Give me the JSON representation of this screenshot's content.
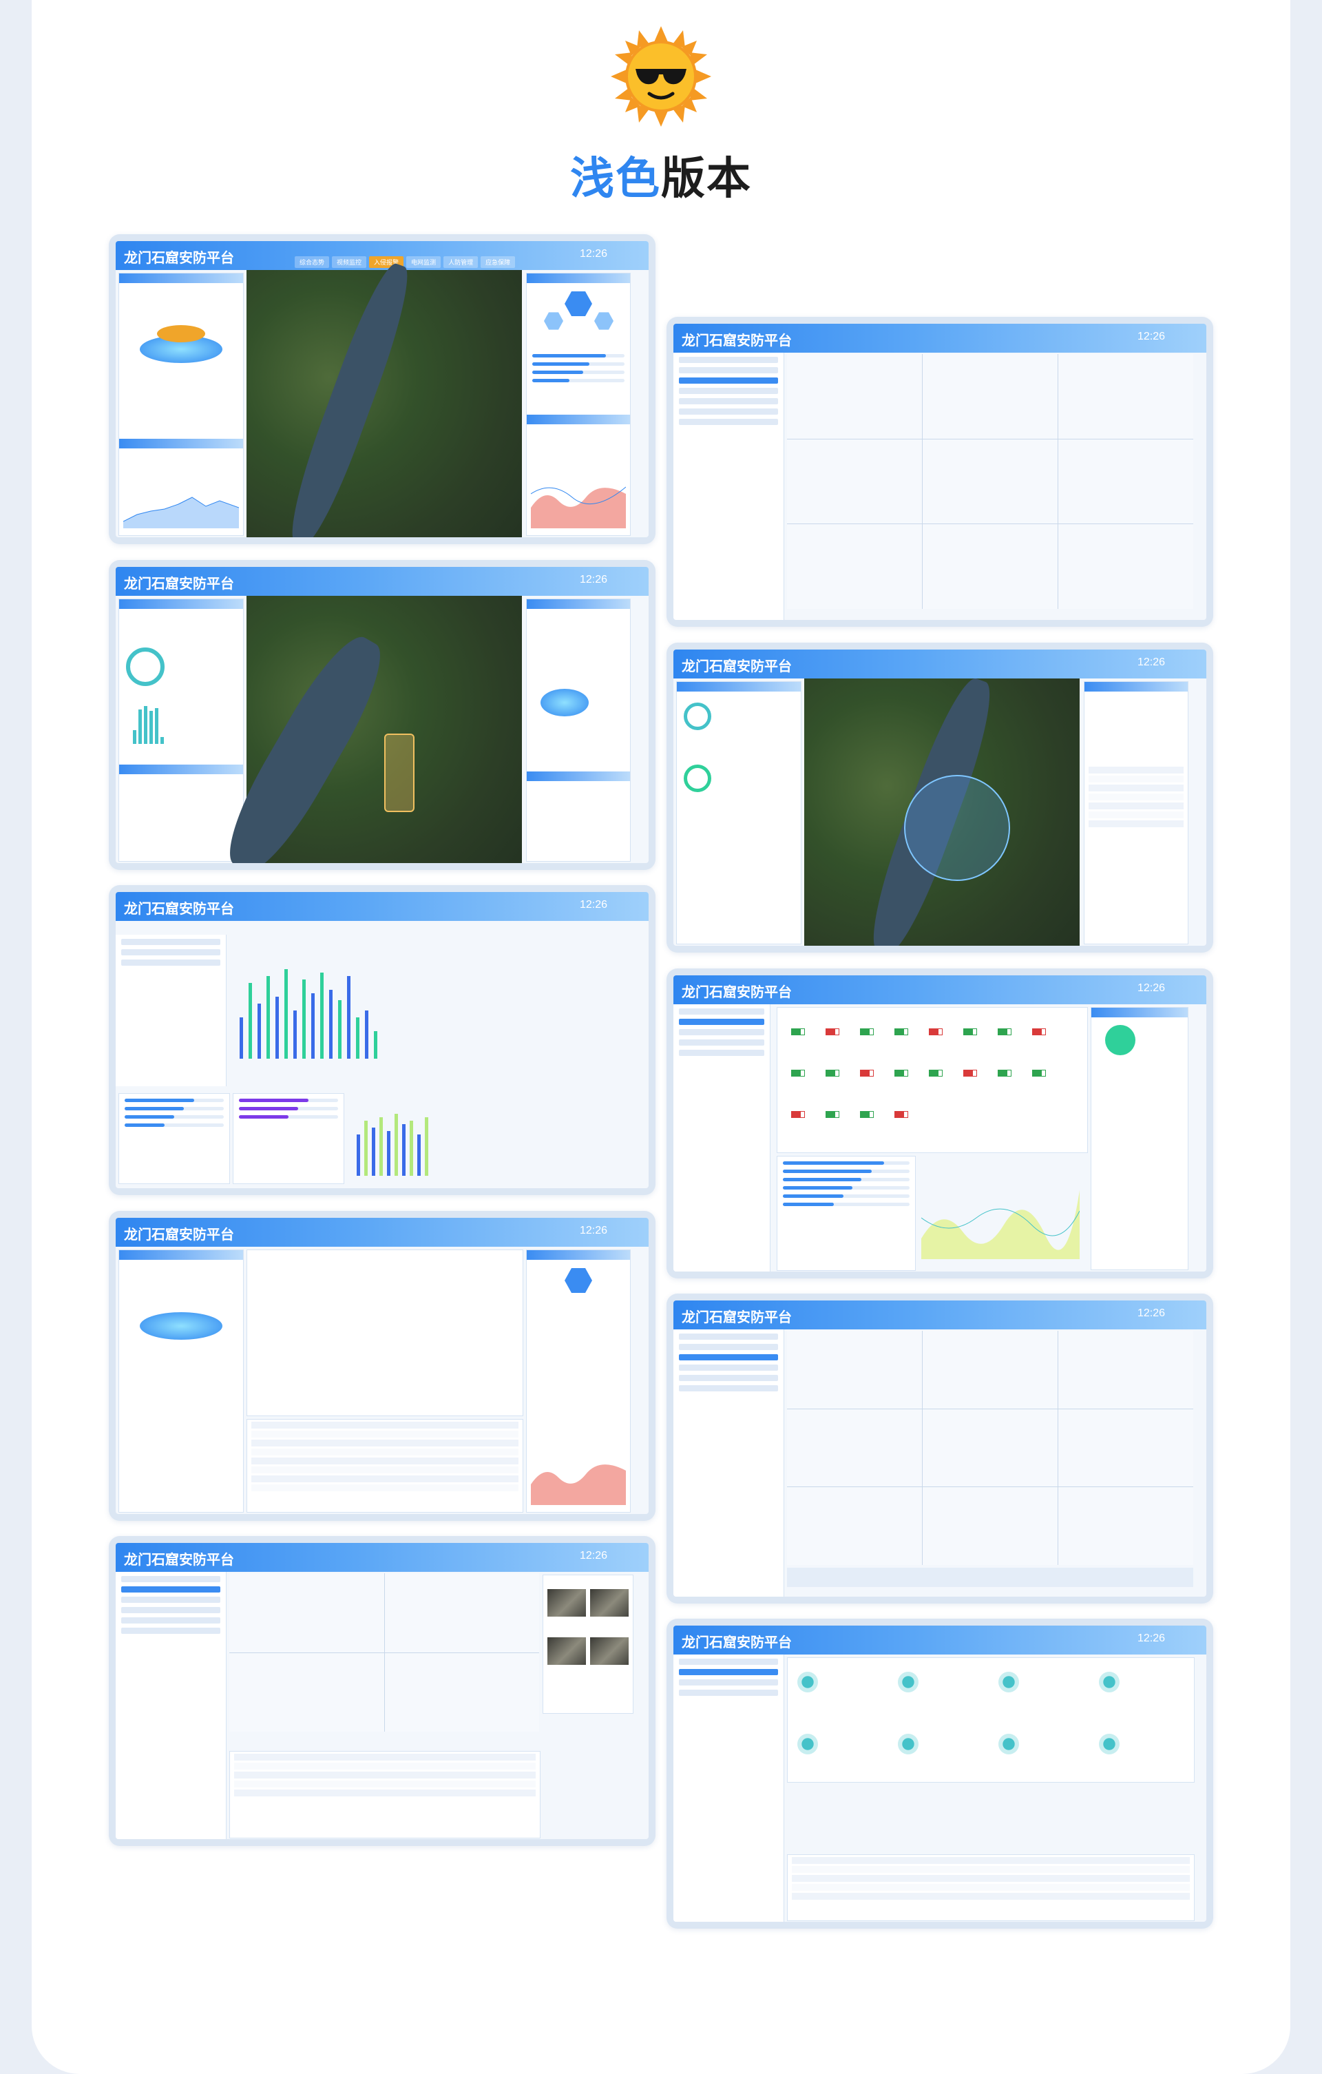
{
  "heading": {
    "highlight": "浅色",
    "rest": "版本"
  },
  "platform_title": "龙门石窟安防平台",
  "nav_tabs": [
    "综合态势",
    "视频监控",
    "入侵报警",
    "电网监测",
    "人防管理",
    "应急保障"
  ],
  "clock": "12:26",
  "colors": {
    "accent": "#2f86f0",
    "warning_tab": "#f0a52a",
    "ok": "#2ea44f",
    "alarm": "#d93a3a",
    "teal": "#44c2c9"
  },
  "icons": [
    "sun-sunglasses-icon",
    "shield-icon",
    "battery-icon",
    "hexagon-icon"
  ]
}
